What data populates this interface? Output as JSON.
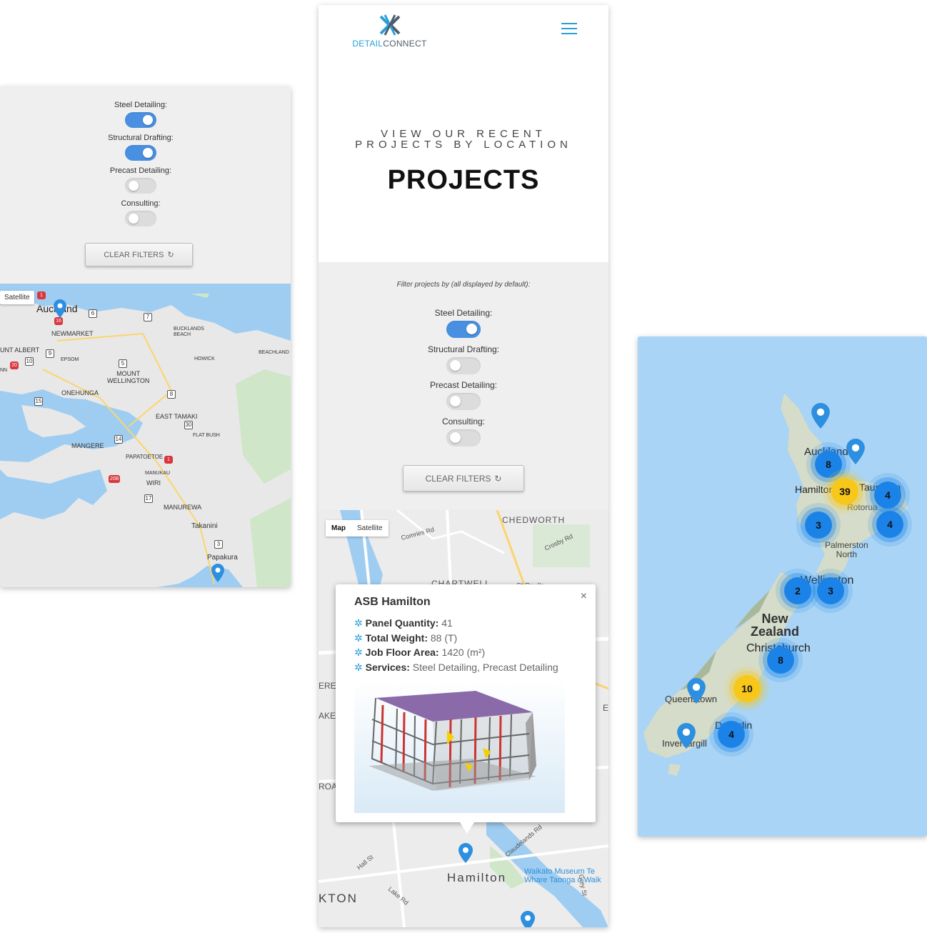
{
  "left_panel": {
    "filters": [
      {
        "label": "Steel Detailing:",
        "on": true
      },
      {
        "label": "Structural Drafting:",
        "on": true
      },
      {
        "label": "Precast Detailing:",
        "on": false
      },
      {
        "label": "Consulting:",
        "on": false
      }
    ],
    "clear_filters": "CLEAR FILTERS",
    "map": {
      "satellite_chip": "Satellite",
      "labels": {
        "auckland": "Auckland",
        "newmarket": "NEWMARKET",
        "mount_albert": "UNT ALBERT",
        "epsom": "EPSOM",
        "bucklands_beach": "BUCKLANDS\nBEACH",
        "howick": "HOWICK",
        "beachlands": "BEACHLAND",
        "mount_wellington": "MOUNT\nWELLINGTON",
        "onehunga": "ONEHUNGA",
        "east_tamaki": "EAST TAMAKI",
        "flat_bush": "FLAT BUSH",
        "mangere": "MANGERE",
        "papatoetoe": "PAPATOETOE",
        "manukau": "MANUKAU",
        "wiri": "WIRI",
        "manurewa": "MANUREWA",
        "takanini": "Takanini",
        "papakura": "Papakura",
        "nn": "NN"
      },
      "shields": [
        "6",
        "7",
        "9",
        "10",
        "5",
        "8",
        "15",
        "30",
        "14",
        "17",
        "3"
      ],
      "red_shields": [
        "1",
        "16",
        "20",
        "1",
        "20B"
      ]
    }
  },
  "middle_panel": {
    "brand_detail": "DETAIL",
    "brand_connect": "CONNECT",
    "subtitle_line1": "VIEW OUR RECENT",
    "subtitle_line2": "PROJECTS BY LOCATION",
    "title": "PROJECTS",
    "filter_intro": "Filter projects by (all displayed by default):",
    "filters": [
      {
        "label": "Steel Detailing:",
        "on": true
      },
      {
        "label": "Structural Drafting:",
        "on": false
      },
      {
        "label": "Precast Detailing:",
        "on": false
      },
      {
        "label": "Consulting:",
        "on": false
      }
    ],
    "clear_filters": "CLEAR FILTERS",
    "map": {
      "map_tab": "Map",
      "satellite_tab": "Satellite",
      "labels": {
        "chedworth": "CHEDWORTH",
        "comries_rd": "Comries Rd",
        "crosby_rd": "Crosby Rd",
        "chartwell": "CHARTWELL",
        "st_pauls": "St Paul's",
        "hamilton": "Hamilton",
        "kton": "KTON",
        "waikato_museum": "Waikato Museum Te\nWhare Taonga o Waik",
        "hall_st": "Hall St",
        "lake_rd": "Lake Rd",
        "claudelands_rd": "Claudelands Rd",
        "grey_st": "Grey St",
        "ere": "ERE",
        "ake": "AKE",
        "roa": "ROA",
        "e": "E"
      },
      "popup": {
        "title": "ASB Hamilton",
        "close": "×",
        "rows": [
          {
            "label": "Panel Quantity:",
            "value": "41"
          },
          {
            "label": "Total Weight:",
            "value": "88 (T)"
          },
          {
            "label": "Job Floor Area:",
            "value": "1420 (m²)"
          },
          {
            "label": "Services:",
            "value": "Steel Detailing, Precast Detailing"
          }
        ]
      }
    }
  },
  "right_panel": {
    "labels": {
      "auckland": "Auckland",
      "hamilton": "Hamilton",
      "tauranga": "Tauranga",
      "rotorua": "Rotorua",
      "palmerston_north": "Palmerston\nNorth",
      "wellington": "Wellington",
      "new_zealand": "New\nZealand",
      "christchurch": "Christchurch",
      "queenstown": "Queenstown",
      "dunedin": "Dunedin",
      "invercargill": "Invercargill"
    },
    "clusters": [
      {
        "count": "8",
        "color": "blue"
      },
      {
        "count": "39",
        "color": "yellow"
      },
      {
        "count": "4",
        "color": "blue"
      },
      {
        "count": "3",
        "color": "blue"
      },
      {
        "count": "4",
        "color": "blue"
      },
      {
        "count": "2",
        "color": "blue"
      },
      {
        "count": "3",
        "color": "blue"
      },
      {
        "count": "8",
        "color": "blue"
      },
      {
        "count": "10",
        "color": "yellow"
      },
      {
        "count": "4",
        "color": "blue"
      }
    ]
  },
  "colors": {
    "accent_blue": "#4a90e2",
    "toggle_off": "#dcdcdc",
    "cluster_blue": "#1b83e8",
    "cluster_yellow": "#f7c81a",
    "sea": "#a9d4f5",
    "brand_blue": "#2a9fd8"
  }
}
